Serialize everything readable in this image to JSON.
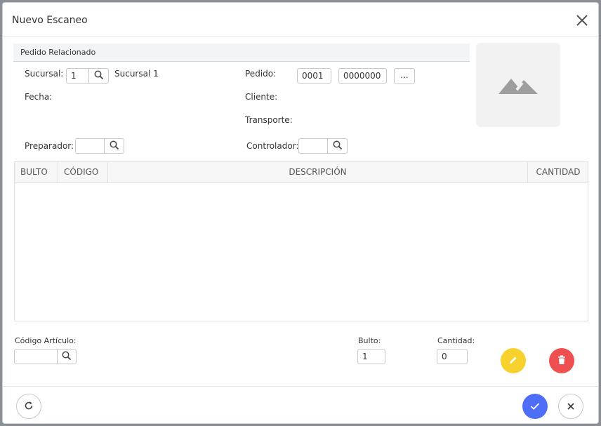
{
  "dialog": {
    "title": "Nuevo Escaneo"
  },
  "section": {
    "title": "Pedido Relacionado"
  },
  "form": {
    "sucursal_label": "Sucursal:",
    "sucursal_value": "1",
    "sucursal_name": "Sucursal 1",
    "fecha_label": "Fecha:",
    "pedido_label": "Pedido:",
    "pedido_prefix": "0001",
    "pedido_number": "0000000",
    "pedido_more": "...",
    "cliente_label": "Cliente:",
    "transporte_label": "Transporte:",
    "preparador_label": "Preparador:",
    "preparador_value": "",
    "controlador_label": "Controlador:",
    "controlador_value": ""
  },
  "table": {
    "columns": [
      "BULTO",
      "CÓDIGO",
      "DESCRIPCIÓN",
      "CANTIDAD"
    ],
    "rows": []
  },
  "entry": {
    "codigo_label": "Código Artículo:",
    "codigo_value": "",
    "bulto_label": "Bulto:",
    "bulto_value": "1",
    "cantidad_label": "Cantidad:",
    "cantidad_value": "0"
  },
  "colors": {
    "edit": "#f7d22d",
    "delete": "#ef4f4f",
    "confirm": "#4f6ef7",
    "icon_gray": "#9e9e9e"
  },
  "icons": [
    "close-icon",
    "search-icon",
    "image-placeholder-icon",
    "pencil-icon",
    "trash-icon",
    "refresh-icon",
    "check-icon",
    "cancel-icon"
  ]
}
